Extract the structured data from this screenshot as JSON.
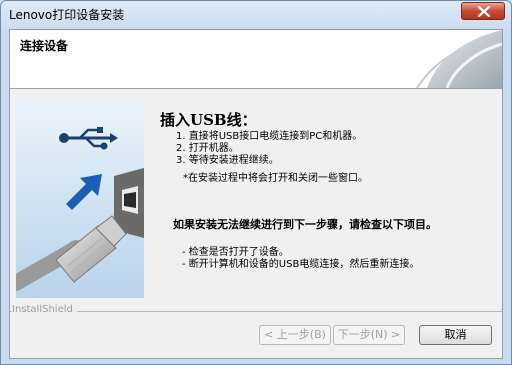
{
  "window": {
    "title": "Lenovo打印设备安装",
    "close_icon": "close-icon"
  },
  "header": {
    "title": "连接设备"
  },
  "content": {
    "heading": "插入USB线：",
    "steps": [
      "1. 直接将USB接口电缆连接到PC和机器。",
      "2. 打开机器。",
      "3. 等待安装进程继续。"
    ],
    "note": "*在安装过程中将会打开和关闭一些窗口。",
    "warning": "如果安装无法继续进行到下一步骤，请检查以下项目。",
    "checks": [
      "- 检查是否打开了设备。",
      "- 断开计算机和设备的USB电缆连接，然后重新连接。"
    ]
  },
  "footer": {
    "brand": "InstallShield",
    "back_label": "< 上一步(B)",
    "next_label": "下一步(N) >",
    "cancel_label": "取消"
  },
  "icons": {
    "usb": "usb-icon",
    "arrow": "arrow-icon",
    "cable": "usb-cable-illustration"
  },
  "colors": {
    "accent": "#1a5fb4",
    "close": "#c74a36"
  }
}
